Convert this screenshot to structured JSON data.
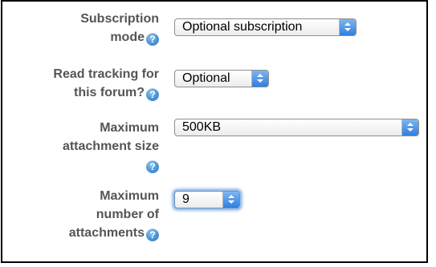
{
  "fields": [
    {
      "label_lines": [
        "Subscription",
        "mode"
      ],
      "value": "Optional subscription",
      "has_help": true
    },
    {
      "label_lines": [
        "Read tracking for",
        "this forum?"
      ],
      "value": "Optional",
      "has_help": true
    },
    {
      "label_lines": [
        "Maximum",
        "attachment size"
      ],
      "value": "500KB",
      "has_help": true
    },
    {
      "label_lines": [
        "Maximum",
        "number of",
        "attachments"
      ],
      "value": "9",
      "has_help": true
    }
  ],
  "help_icon": {
    "glyph": "?",
    "icon": "help-icon",
    "color": "#4a93d6"
  },
  "colors": {
    "label": "#555555",
    "select_arrow": "#2f7fe0",
    "focus_ring": "#6fa6e0"
  }
}
